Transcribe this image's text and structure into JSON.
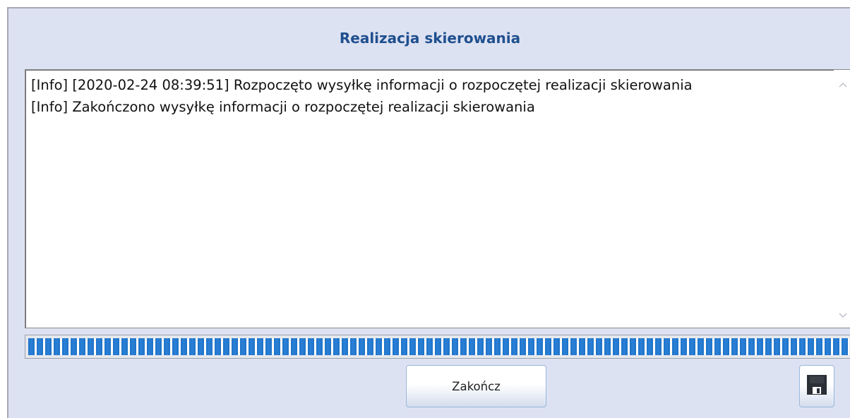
{
  "dialog": {
    "title": "Realizacja skierowania"
  },
  "log": {
    "text": "[Info] [2020-02-24 08:39:51] Rozpoczęto wysyłkę informacji o rozpoczętej realizacji skierowania\n[Info] Zakończono wysyłkę informacji o rozpoczętej realizacji skierowania"
  },
  "progress": {
    "percent": 100,
    "color": "#1f73c6"
  },
  "buttons": {
    "finish_label": "Zakończ",
    "save_icon": "floppy-disk-icon"
  },
  "colors": {
    "dialog_background": "#dde2f2",
    "title_color": "#1f4f8e"
  }
}
